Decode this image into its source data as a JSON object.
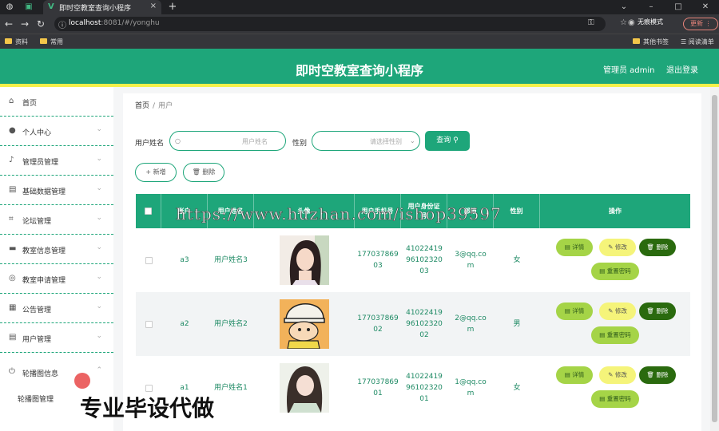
{
  "browser": {
    "tab_title": "即时空教室查询小程序",
    "url_host": "localhost",
    "url_path": ":8081/#/yonghu",
    "incognito_label": "无痕模式",
    "update_label": "更新",
    "bookmarks": [
      "资料",
      "常用"
    ],
    "bookmarks_right": [
      "其他书签",
      "阅读清单"
    ]
  },
  "header": {
    "title": "即时空教室查询小程序",
    "admin_label": "管理员 admin",
    "logout_label": "退出登录"
  },
  "sidebar": {
    "items": [
      {
        "label": "首页",
        "icon": "home-icon"
      },
      {
        "label": "个人中心",
        "icon": "user-icon"
      },
      {
        "label": "管理员管理",
        "icon": "mic-icon"
      },
      {
        "label": "基础数据管理",
        "icon": "briefcase-icon"
      },
      {
        "label": "论坛管理",
        "icon": "crop-icon"
      },
      {
        "label": "教室信息管理",
        "icon": "chat-icon"
      },
      {
        "label": "教室申请管理",
        "icon": "globe-icon"
      },
      {
        "label": "公告管理",
        "icon": "film-icon"
      },
      {
        "label": "用户管理",
        "icon": "list-icon"
      },
      {
        "label": "轮播图信息",
        "icon": "power-icon"
      }
    ],
    "submenu_label": "轮播图管理"
  },
  "breadcrumb": {
    "home": "首页",
    "separator": "/",
    "current": "用户"
  },
  "filters": {
    "name_label": "用户姓名",
    "name_placeholder": "用户姓名",
    "gender_label": "性别",
    "gender_placeholder": "请选择性别",
    "query_label": "查询"
  },
  "actions": {
    "add_label": "新增",
    "delete_label": "删除"
  },
  "table": {
    "columns": [
      "账户",
      "用户姓名",
      "头像",
      "用户手机号",
      "用户身份证号",
      "邮箱",
      "性别",
      "操作"
    ],
    "rows": [
      {
        "account": "a3",
        "name": "用户姓名3",
        "phone": "17703786903",
        "idcard": "410224199610232003",
        "email": "3@qq.com",
        "gender": "女"
      },
      {
        "account": "a2",
        "name": "用户姓名2",
        "phone": "17703786902",
        "idcard": "410224199610232002",
        "email": "2@qq.com",
        "gender": "男"
      },
      {
        "account": "a1",
        "name": "用户姓名1",
        "phone": "17703786901",
        "idcard": "410224199610232001",
        "email": "1@qq.com",
        "gender": "女"
      }
    ],
    "row_buttons": {
      "detail": "详情",
      "edit": "修改",
      "delete": "删除",
      "reset": "重置密码"
    }
  },
  "overlay": {
    "watermark": "https://www.huzhan.com/ishop39597",
    "promo": "专业毕设代做"
  },
  "colors": {
    "primary": "#1ea67a",
    "accent_yellow": "#f5f04a",
    "detail": "#a5d447",
    "edit": "#f5f47a",
    "delete": "#2a6a0e"
  }
}
